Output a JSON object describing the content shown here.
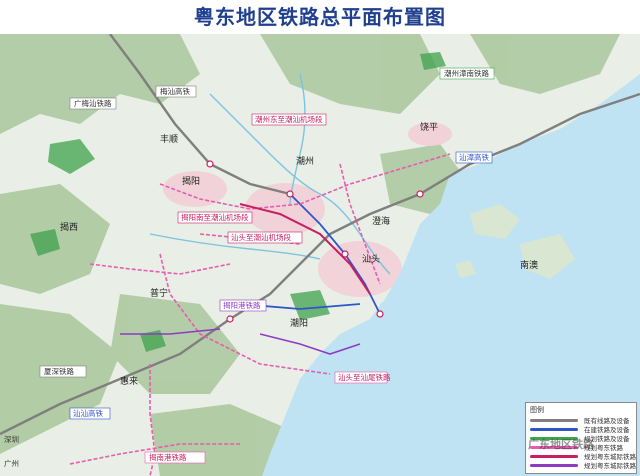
{
  "title": "粤东地区铁路总平面布置图",
  "colors": {
    "water": "#bfe3f3",
    "land": "#e9efe6",
    "hills": "#9fbf94",
    "urban": "#f4d4dc",
    "existing": "#7f7f7f",
    "construction": "#2f56c8",
    "planned": "#e85bb0",
    "highspeed": "#c81e62",
    "link": "#8e3bc4"
  },
  "rail_labels": {
    "guangmei": "广梅汕铁路",
    "meishan": "梅汕高铁",
    "chaoshan_airport": "潮州东至潮汕机场段",
    "jieyang_airport": "揭阳南至潮汕机场段",
    "shantou_airport": "汕头至潮汕机场段",
    "zhangzhou": "潮州漳南铁路",
    "shanzhang": "汕漳高铁",
    "xiamen_shenzhen": "厦深铁路",
    "shanshan": "汕汕高铁",
    "shantou_south": "汕头至汕尾铁路",
    "jieyang_nan": "揭南港铁路",
    "meizhou_link": "揭阳港铁路",
    "wei_left": "广州",
    "wei_left2": "深圳"
  },
  "place_labels": {
    "jieyang": "揭阳",
    "chaozhou": "潮州",
    "shantou": "汕头",
    "jiexi": "揭西",
    "puning": "普宁",
    "huilai": "惠来",
    "chaoyang": "潮阳",
    "chenghai": "澄海",
    "raoping": "饶平",
    "fengshun": "丰顺",
    "nan_ao": "南澳"
  },
  "legend": {
    "title": "图例",
    "items": [
      {
        "label": "既有线路及设备",
        "color": "#7f7f7f"
      },
      {
        "label": "在建铁路及设备",
        "color": "#2f56c8"
      },
      {
        "label": "规划铁路及设备",
        "color": "#3aa64c"
      },
      {
        "label": "规划粤东铁路",
        "color": "#e85bb0"
      },
      {
        "label": "规划粤东城际铁路",
        "color": "#c81e62"
      },
      {
        "label": "规划粤东城际铁路",
        "color": "#8e3bc4"
      }
    ]
  },
  "watermark": "广东地区铁路"
}
